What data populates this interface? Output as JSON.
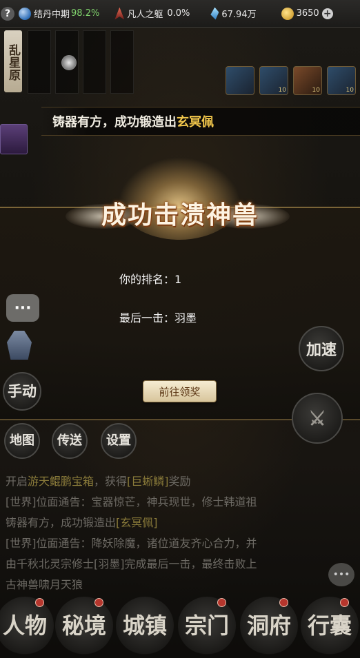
{
  "topbar": {
    "help": "?",
    "realm_label": "结丹中期",
    "realm_pct": "98.2%",
    "body_label": "凡人之躯",
    "body_pct": "0.0%",
    "crystal_value": "67.94万",
    "coin_value": "3650",
    "plus": "+"
  },
  "location": {
    "name": "乱星原"
  },
  "banner": {
    "prefix": "铸器有方，成功锻造出",
    "item": "玄冥佩"
  },
  "result": {
    "title": "成功击溃神兽",
    "rank_label": "你的排名：",
    "rank_value": "1",
    "last_hit_label": "最后一击：",
    "last_hit_value": "羽墨",
    "claim_button": "前往领奖"
  },
  "side": {
    "chat": "···",
    "manual": "手动",
    "speed": "加速"
  },
  "menu": {
    "map": "地图",
    "teleport": "传送",
    "settings": "设置"
  },
  "chatlog": [
    {
      "a": "开启",
      "b": "游天鲲鹏宝箱",
      "c": "，获得",
      "d": "[巨蜥鳞]",
      "e": "奖励"
    },
    {
      "a": "[世界]位面通告：宝器惊芒，神兵现世，修士韩道祖"
    },
    {
      "a": "铸器有方，成功锻造出",
      "b": "[玄冥佩]"
    },
    {
      "a": "[世界]位面通告：降妖除魔，诸位道友齐心合力，并"
    },
    {
      "a": "由千秋北灵宗修士",
      "b": "[羽墨]",
      "c": "完成最后一击，最终击败上"
    },
    {
      "a": "古神兽啸月天狼"
    }
  ],
  "nav": [
    {
      "label": "人物"
    },
    {
      "label": "秘境"
    },
    {
      "label": "城镇"
    },
    {
      "label": "宗门"
    },
    {
      "label": "洞府"
    },
    {
      "label": "行囊"
    }
  ],
  "items": [
    {
      "count": ""
    },
    {
      "count": "10"
    },
    {
      "count": "10"
    },
    {
      "count": "10"
    }
  ],
  "colors": {
    "accent_gold": "#f2c74c",
    "realm_green": "#7fd26c",
    "badge_red": "#b6362d"
  }
}
